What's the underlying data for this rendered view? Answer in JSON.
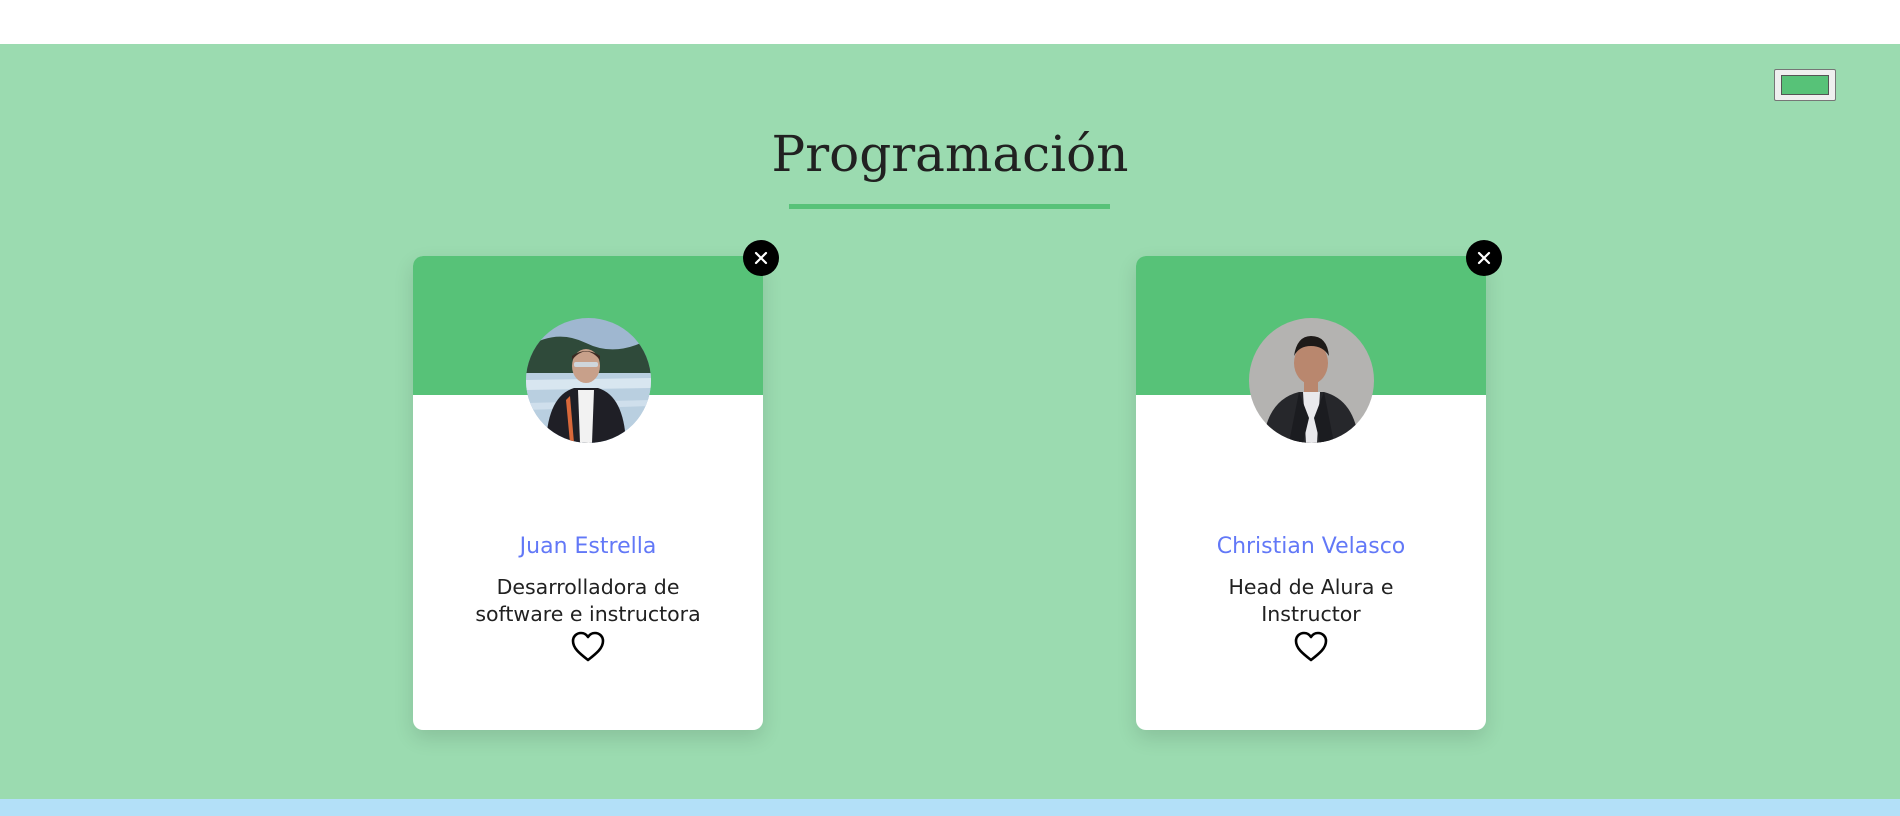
{
  "colors": {
    "section_bg": "#9bdbb0",
    "primary": "#57c278",
    "name_color": "#6278f7",
    "bottom_strip": "#b3e0f8"
  },
  "controls": {
    "color_picker_value": "#57c278"
  },
  "section": {
    "title": "Programación"
  },
  "cards": [
    {
      "name": "Juan Estrella",
      "role": "Desarrolladora de software e instructora",
      "delete_icon": "close-icon",
      "favorite_icon": "heart-outline-icon"
    },
    {
      "name": "Christian Velasco",
      "role": "Head de Alura e Instructor",
      "delete_icon": "close-icon",
      "favorite_icon": "heart-outline-icon"
    }
  ]
}
